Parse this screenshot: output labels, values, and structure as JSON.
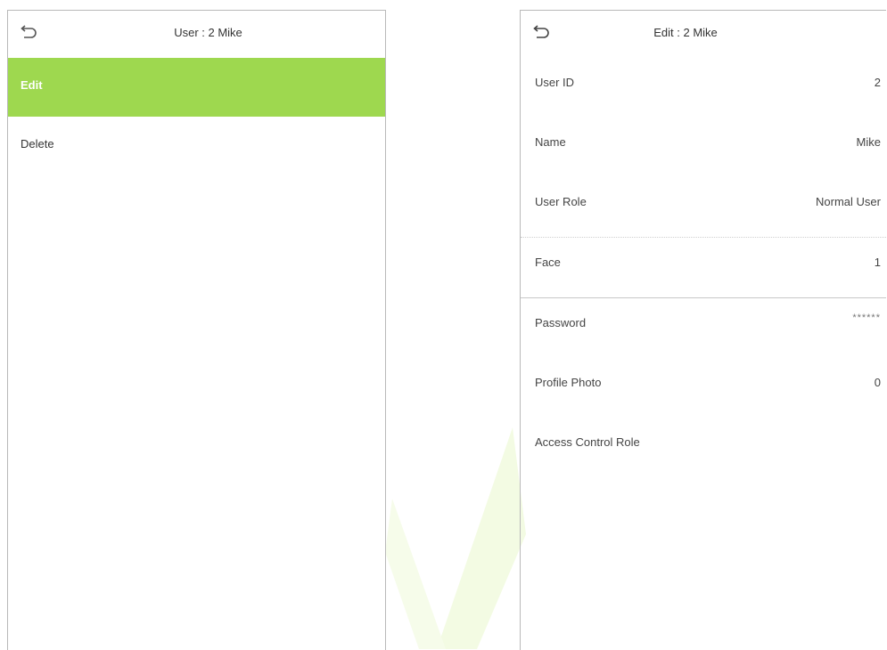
{
  "left_panel": {
    "title": "User : 2 Mike",
    "items": [
      {
        "label": "Edit"
      },
      {
        "label": "Delete"
      }
    ]
  },
  "right_panel": {
    "title": "Edit : 2 Mike",
    "rows": [
      {
        "label": "User ID",
        "value": "2"
      },
      {
        "label": "Name",
        "value": "Mike"
      },
      {
        "label": "User Role",
        "value": "Normal User"
      },
      {
        "label": "Face",
        "value": "1"
      },
      {
        "label": "Password",
        "value": "******"
      },
      {
        "label": "Profile Photo",
        "value": "0"
      },
      {
        "label": "Access Control Role",
        "value": ""
      }
    ]
  },
  "colors": {
    "selected_bg": "#9ed84f",
    "watermark": "#f2fbdd"
  }
}
